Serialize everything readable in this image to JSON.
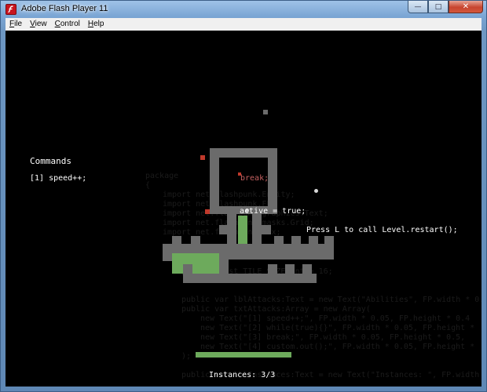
{
  "window": {
    "title": "Adobe Flash Player 11",
    "controls": {
      "minimize": "—",
      "maximize": "□",
      "close": "✕"
    }
  },
  "menu": [
    {
      "key": "F",
      "rest": "ile"
    },
    {
      "key": "V",
      "rest": "iew"
    },
    {
      "key": "C",
      "rest": "ontrol"
    },
    {
      "key": "H",
      "rest": "elp"
    }
  ],
  "hud": {
    "commands_title": "Commands",
    "command_1": "[1] speed++;",
    "break_label": "break;",
    "active_label": "active = true;",
    "restart_hint": "Press L to call Level.restart();",
    "instances_label": "Instances: 3/3"
  },
  "background_code": {
    "l1": "package",
    "l2": "{",
    "l3": "import net.flashpunk.Entity;",
    "l4": "import net.flashpunk.FP;",
    "l5": "import net.flashpunk.graphics.Text;",
    "l6": "import net.flashpunk.masks.Grid;",
    "l7": "import net.flashpunk.Sfx;",
    "l8": "public const TILE_SIZE:int = 16;",
    "l9": "public var lblAttacks:Text = new Text(\"Abilities\", FP.width * 0.",
    "l10": "public var txtAttacks:Array = new Array(",
    "l11": "new Text(\"[1] speed++;\", FP.width * 0.05, FP.height * 0.4",
    "l12": "new Text(\"[2] while(true){}\", FP.width * 0.05, FP.height *",
    "l13": "new Text(\"[3] break;\", FP.width * 0.05, FP.height * 0.5,",
    "l14": "new Text(\"[4] custom.out();\", FP.width * 0.05, FP.height *",
    "l15": ");",
    "l16": "public var lblInstances:Text = new Text(\"Instances: \", FP.width"
  }
}
